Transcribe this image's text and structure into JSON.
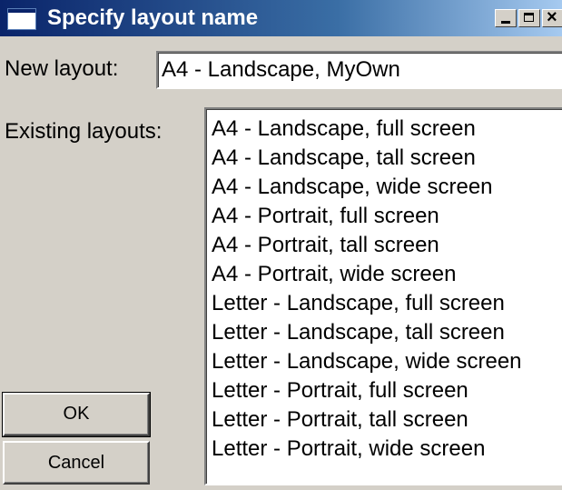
{
  "window": {
    "title": "Specify layout name",
    "icon": "window-icon",
    "controls": {
      "minimize": "minimize-icon",
      "maximize": "maximize-icon",
      "close": "×"
    }
  },
  "form": {
    "new_layout_label": "New layout:",
    "new_layout_value": "A4 - Landscape, MyOwn",
    "existing_layouts_label": "Existing layouts:",
    "existing_layouts": [
      "A4 - Landscape, full screen",
      "A4 - Landscape, tall screen",
      "A4 - Landscape, wide screen",
      "A4 - Portrait, full screen",
      "A4 - Portrait, tall screen",
      "A4 - Portrait, wide screen",
      "Letter - Landscape, full screen",
      "Letter - Landscape, tall screen",
      "Letter - Landscape, wide screen",
      "Letter - Portrait, full screen",
      "Letter - Portrait, tall screen",
      "Letter - Portrait, wide screen"
    ]
  },
  "buttons": {
    "ok": "OK",
    "cancel": "Cancel"
  }
}
